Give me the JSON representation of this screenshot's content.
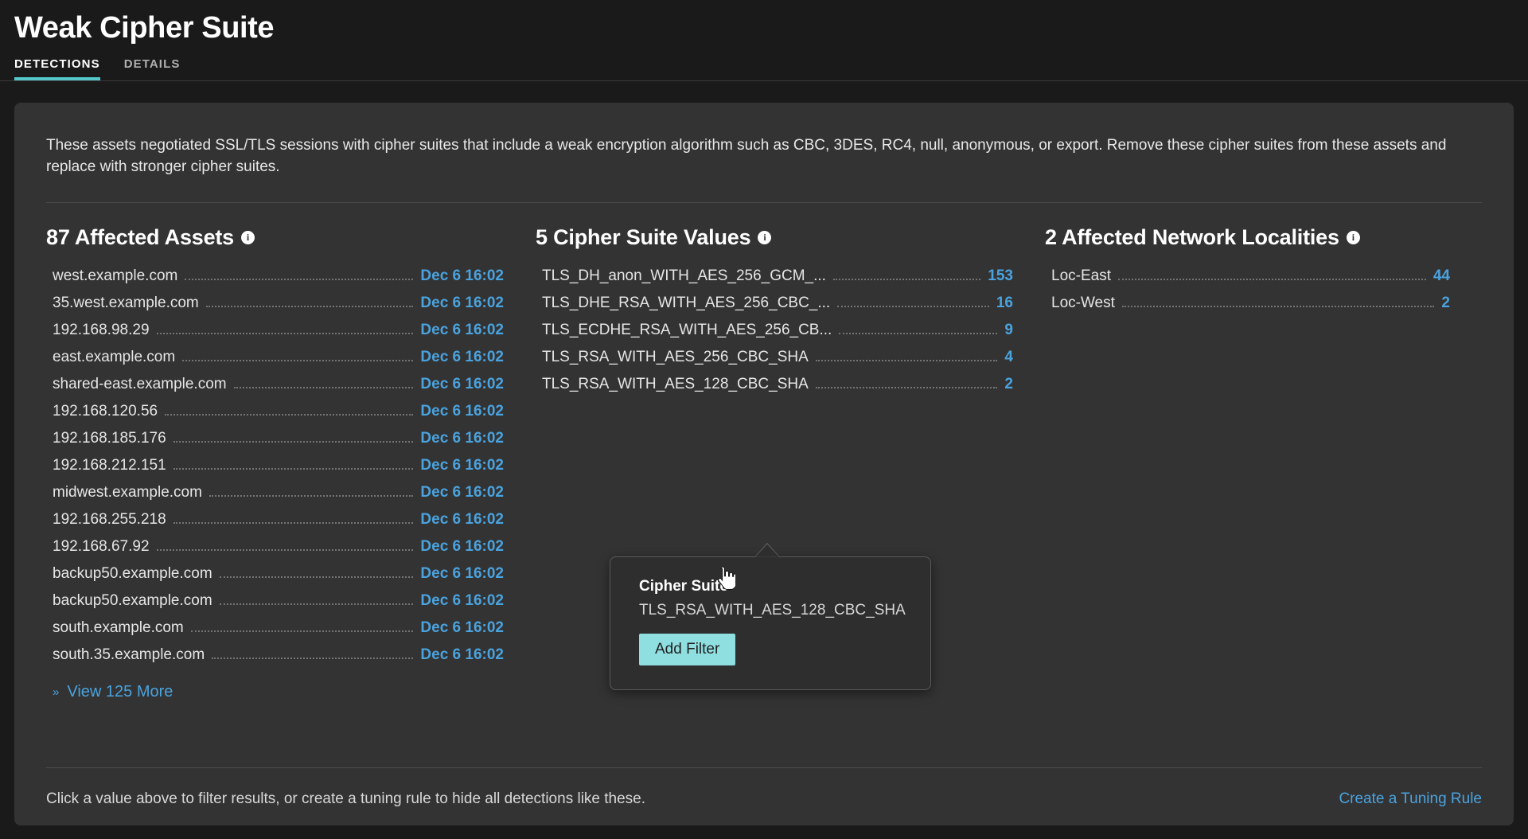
{
  "header": {
    "title": "Weak Cipher Suite",
    "tabs": [
      {
        "label": "DETECTIONS",
        "active": true
      },
      {
        "label": "DETAILS",
        "active": false
      }
    ]
  },
  "description": "These assets negotiated SSL/TLS sessions with cipher suites that include a weak encryption algorithm such as CBC, 3DES, RC4, null, anonymous, or export. Remove these cipher suites from these assets and replace with stronger cipher suites.",
  "columns": {
    "assets": {
      "title": "87 Affected Assets",
      "info_icon": "info-icon",
      "rows": [
        {
          "label": "west.example.com",
          "value": "Dec 6 16:02"
        },
        {
          "label": "35.west.example.com",
          "value": "Dec 6 16:02"
        },
        {
          "label": "192.168.98.29",
          "value": "Dec 6 16:02"
        },
        {
          "label": "east.example.com",
          "value": "Dec 6 16:02"
        },
        {
          "label": "shared-east.example.com",
          "value": "Dec 6 16:02"
        },
        {
          "label": "192.168.120.56",
          "value": "Dec 6 16:02"
        },
        {
          "label": "192.168.185.176",
          "value": "Dec 6 16:02"
        },
        {
          "label": "192.168.212.151",
          "value": "Dec 6 16:02"
        },
        {
          "label": "midwest.example.com",
          "value": "Dec 6 16:02"
        },
        {
          "label": "192.168.255.218",
          "value": "Dec 6 16:02"
        },
        {
          "label": "192.168.67.92",
          "value": "Dec 6 16:02"
        },
        {
          "label": "backup50.example.com",
          "value": "Dec 6 16:02"
        },
        {
          "label": "backup50.example.com",
          "value": "Dec 6 16:02"
        },
        {
          "label": "south.example.com",
          "value": "Dec 6 16:02"
        },
        {
          "label": "south.35.example.com",
          "value": "Dec 6 16:02"
        }
      ],
      "view_more": "View 125 More",
      "view_more_icon": "chevron-double-down-icon"
    },
    "ciphers": {
      "title": "5 Cipher Suite Values",
      "info_icon": "info-icon",
      "rows": [
        {
          "label": "TLS_DH_anon_WITH_AES_256_GCM_...",
          "value": "153"
        },
        {
          "label": "TLS_DHE_RSA_WITH_AES_256_CBC_...",
          "value": "16"
        },
        {
          "label": "TLS_ECDHE_RSA_WITH_AES_256_CB...",
          "value": "9"
        },
        {
          "label": "TLS_RSA_WITH_AES_256_CBC_SHA",
          "value": "4"
        },
        {
          "label": "TLS_RSA_WITH_AES_128_CBC_SHA",
          "value": "2"
        }
      ]
    },
    "localities": {
      "title": "2 Affected Network Localities",
      "info_icon": "info-icon",
      "rows": [
        {
          "label": "Loc-East",
          "value": "44"
        },
        {
          "label": "Loc-West",
          "value": "2"
        }
      ]
    }
  },
  "popover": {
    "title": "Cipher Suite",
    "value": "TLS_RSA_WITH_AES_128_CBC_SHA",
    "button_label": "Add Filter"
  },
  "footer": {
    "note": "Click a value above to filter results, or create a tuning rule to hide all detections like these.",
    "link": "Create a Tuning Rule"
  },
  "colors": {
    "page_background": "#1a1a1a",
    "card_background": "#333333",
    "accent_teal": "#55c6c9",
    "link_blue": "#4aa3df",
    "button_teal": "#8fdee0"
  }
}
